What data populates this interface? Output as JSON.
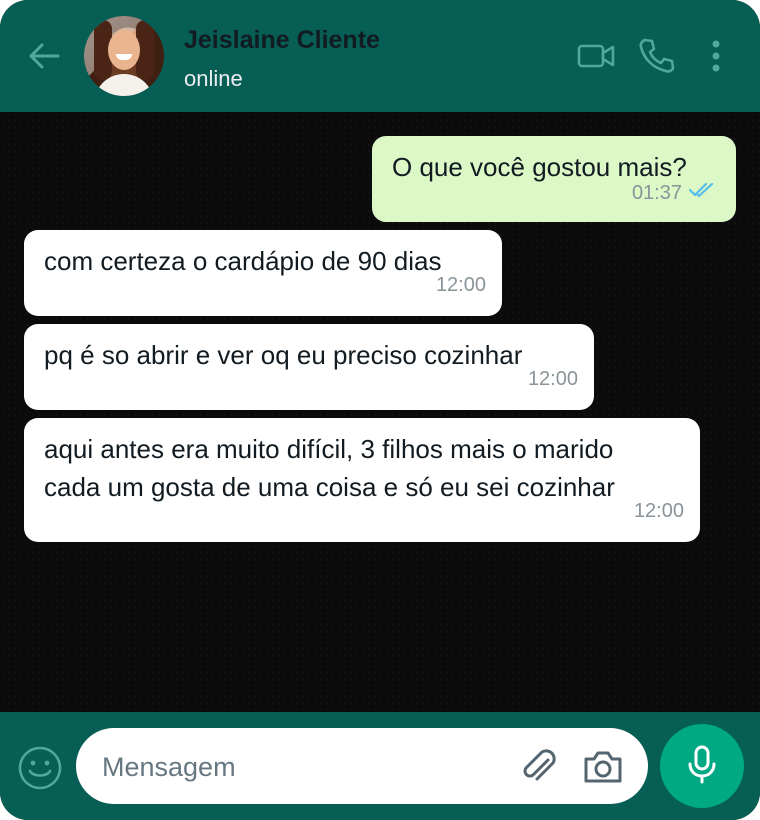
{
  "header": {
    "contact_name": "Jeislaine Cliente",
    "status": "online",
    "icons": [
      "back-arrow-icon",
      "video-call-icon",
      "phone-icon",
      "more-options-icon"
    ]
  },
  "messages": [
    {
      "direction": "outgoing",
      "text": "O que você gostou mais?",
      "time": "01:37",
      "read": true
    },
    {
      "direction": "incoming",
      "text": "com certeza o cardápio de 90 dias",
      "time": "12:00"
    },
    {
      "direction": "incoming",
      "text": "pq é so abrir e ver oq eu preciso cozinhar",
      "time": "12:00"
    },
    {
      "direction": "incoming",
      "text": "aqui antes era muito difícil, 3 filhos mais o marido\ncada um gosta de uma coisa e só eu sei cozinhar",
      "time": "12:00"
    }
  ],
  "composer": {
    "placeholder": "Mensagem",
    "value": ""
  },
  "colors": {
    "header_bg": "#075e54",
    "outgoing_bubble": "#dcf8c6",
    "incoming_bubble": "#ffffff",
    "mic_button": "#00a884",
    "read_ticks": "#53bdeb"
  }
}
